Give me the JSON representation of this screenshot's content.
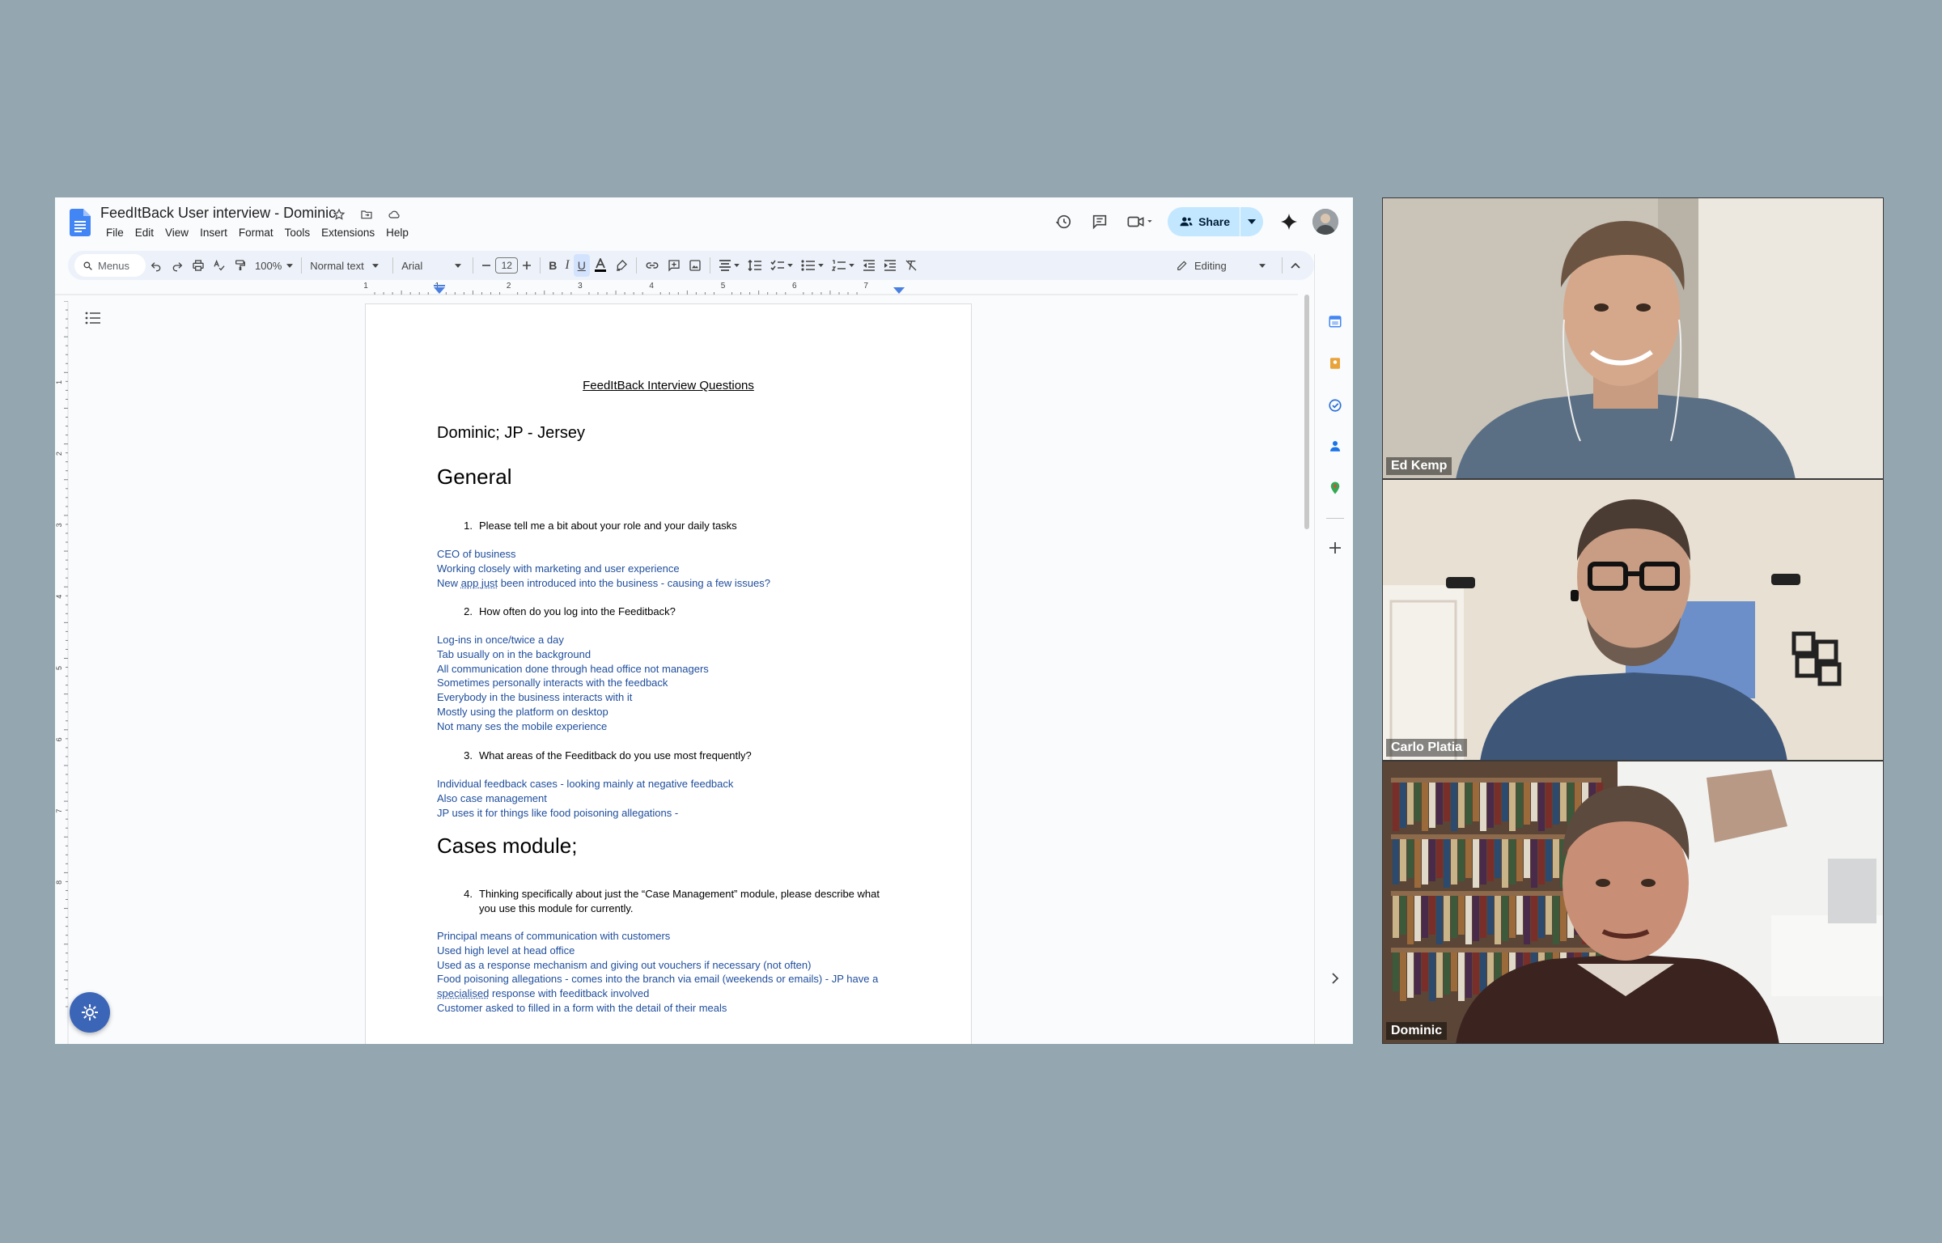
{
  "docs": {
    "title": "FeedItBack User interview - Dominic",
    "menus": [
      "File",
      "Edit",
      "View",
      "Insert",
      "Format",
      "Tools",
      "Extensions",
      "Help"
    ],
    "share_label": "Share",
    "toolbar": {
      "search_placeholder": "Menus",
      "zoom": "100%",
      "style": "Normal text",
      "font": "Arial",
      "font_size": "12",
      "mode": "Editing"
    },
    "ruler_labels": [
      "1",
      "1",
      "2",
      "3",
      "4",
      "5",
      "6",
      "7"
    ],
    "left_ruler_labels": [
      "1",
      "2",
      "3",
      "4",
      "5",
      "6",
      "7",
      "8"
    ],
    "document": {
      "title": "FeedItBack Interview Questions",
      "subtitle": "Dominic; JP - Jersey",
      "section_general": "General",
      "q1": {
        "num": "1.",
        "text": "Please tell me a bit about your role and your daily tasks"
      },
      "a1": [
        "CEO of business",
        "Working closely with marketing and user experience"
      ],
      "a1_last_pre": "New ",
      "a1_last_squig": "app just",
      "a1_last_post": " been introduced into the business - causing a few issues?",
      "q2": {
        "num": "2.",
        "text": "How often do you log into the Feeditback?"
      },
      "a2": [
        "Log-ins in once/twice a day",
        "Tab usually on in the background",
        "All communication done through head office not managers",
        "Sometimes personally interacts with the feedback",
        "Everybody in the business interacts with it",
        "Mostly using the platform on desktop",
        "Not many ses the mobile experience"
      ],
      "q3": {
        "num": "3.",
        "text": "What areas of the Feeditback do you use most frequently?"
      },
      "a3": [
        "Individual feedback cases - looking mainly at negative feedback",
        "Also case management",
        "JP uses it for things like food poisoning allegations -"
      ],
      "section_cases": "Cases module;",
      "q4": {
        "num": "4.",
        "line1": "Thinking specifically about just the “Case Management” module, please describe what",
        "line2": "you use this module for currently."
      },
      "a4": [
        "Principal means of communication with customers",
        "Used high level at head office",
        "Used as a response mechanism and giving out vouchers if necessary (not often)",
        "Food poisoning allegations - comes into the branch via email (weekends or emails) - JP have a"
      ],
      "a4_squig": "specialised",
      "a4_squig_post": " response with feeditback involved",
      "a4_last": "Customer asked to filled in a form with the detail of their meals"
    }
  },
  "video_participants": [
    {
      "name": "Ed Kemp"
    },
    {
      "name": "Carlo Platia"
    },
    {
      "name": "Dominic"
    }
  ],
  "colors": {
    "background": "#94a7b1",
    "answer_text": "#1f4e9c",
    "share_button": "#c2e7ff",
    "toolbar_bg": "#edf2fa",
    "fab": "#3b65b7"
  }
}
